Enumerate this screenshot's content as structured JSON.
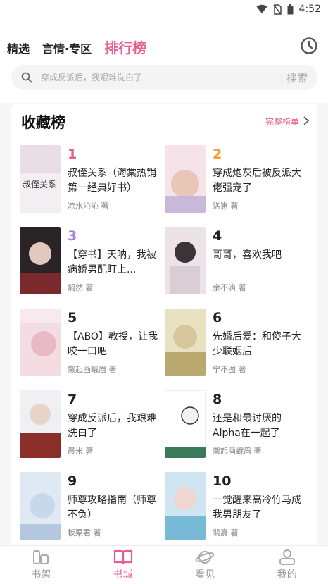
{
  "status_bar": {
    "time": "4:52",
    "icons": [
      "wifi-icon",
      "no-sim-icon",
      "battery-icon"
    ]
  },
  "header": {
    "tabs": [
      {
        "label": "精选"
      },
      {
        "label": "言情·专区"
      },
      {
        "label": "排行榜"
      }
    ],
    "history_icon": "clock-icon"
  },
  "search": {
    "placeholder": "穿成反派后，我艰难洗白了",
    "button_label": "搜索",
    "separator": "|"
  },
  "ranking": {
    "title": "收藏榜",
    "more_label": "完整榜单",
    "items": [
      {
        "rank": "1",
        "title": "叔侄关系（海棠热销第一经典好书）",
        "author": "凉水沁沁 著"
      },
      {
        "rank": "2",
        "title": "穿成炮灰后被反派大佬强宠了",
        "author": "洛崽 著"
      },
      {
        "rank": "3",
        "title": "【穿书】天呐，我被病娇男配盯上...",
        "author": "焖然 著"
      },
      {
        "rank": "4",
        "title": "哥哥，喜欢我吧",
        "author": "余不滴 著"
      },
      {
        "rank": "5",
        "title": "【ABO】教授，让我咬一口吧",
        "author": "懒起画峨眉 著"
      },
      {
        "rank": "6",
        "title": "先婚后爱：和傻子大少联姻后",
        "author": "宁不图 著"
      },
      {
        "rank": "7",
        "title": "穿成反派后，我艰难洗白了",
        "author": "晨米 著"
      },
      {
        "rank": "8",
        "title": "还是和最讨厌的Alpha在一起了",
        "author": "懒起画蛾眉 著"
      },
      {
        "rank": "9",
        "title": "师尊攻略指南（师尊不负）",
        "author": "板栗君 著"
      },
      {
        "rank": "10",
        "title": "一觉醒来高冷竹马成我男朋友了",
        "author": "裴嘉 著"
      }
    ]
  },
  "bottom_nav": [
    {
      "label": "书架",
      "icon": "bookshelf-icon"
    },
    {
      "label": "书城",
      "icon": "book-open-icon"
    },
    {
      "label": "看见",
      "icon": "planet-icon"
    },
    {
      "label": "我的",
      "icon": "user-icon"
    }
  ],
  "colors": {
    "accent": "#e85d8f",
    "rank2": "#f0a03a",
    "rank3": "#a786d8"
  }
}
